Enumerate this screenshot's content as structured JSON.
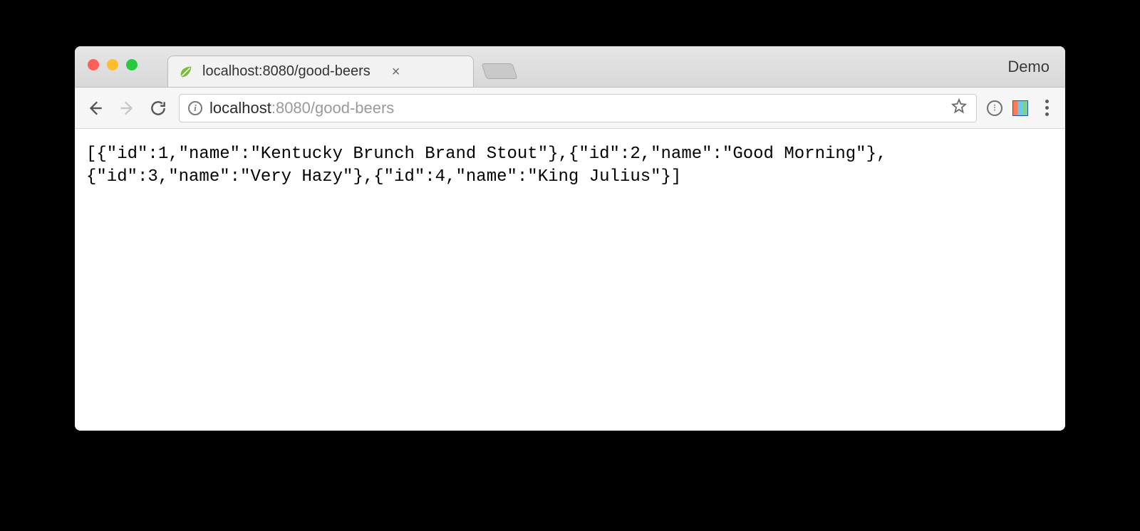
{
  "window": {
    "profile_label": "Demo",
    "tab": {
      "title": "localhost:8080/good-beers",
      "favicon": "spring-leaf-icon"
    }
  },
  "address_bar": {
    "security_icon": "info-icon",
    "url_host": "localhost",
    "url_rest": ":8080/good-beers"
  },
  "page": {
    "json_text": "[{\"id\":1,\"name\":\"Kentucky Brunch Brand Stout\"},{\"id\":2,\"name\":\"Good Morning\"},{\"id\":3,\"name\":\"Very Hazy\"},{\"id\":4,\"name\":\"King Julius\"}]"
  }
}
